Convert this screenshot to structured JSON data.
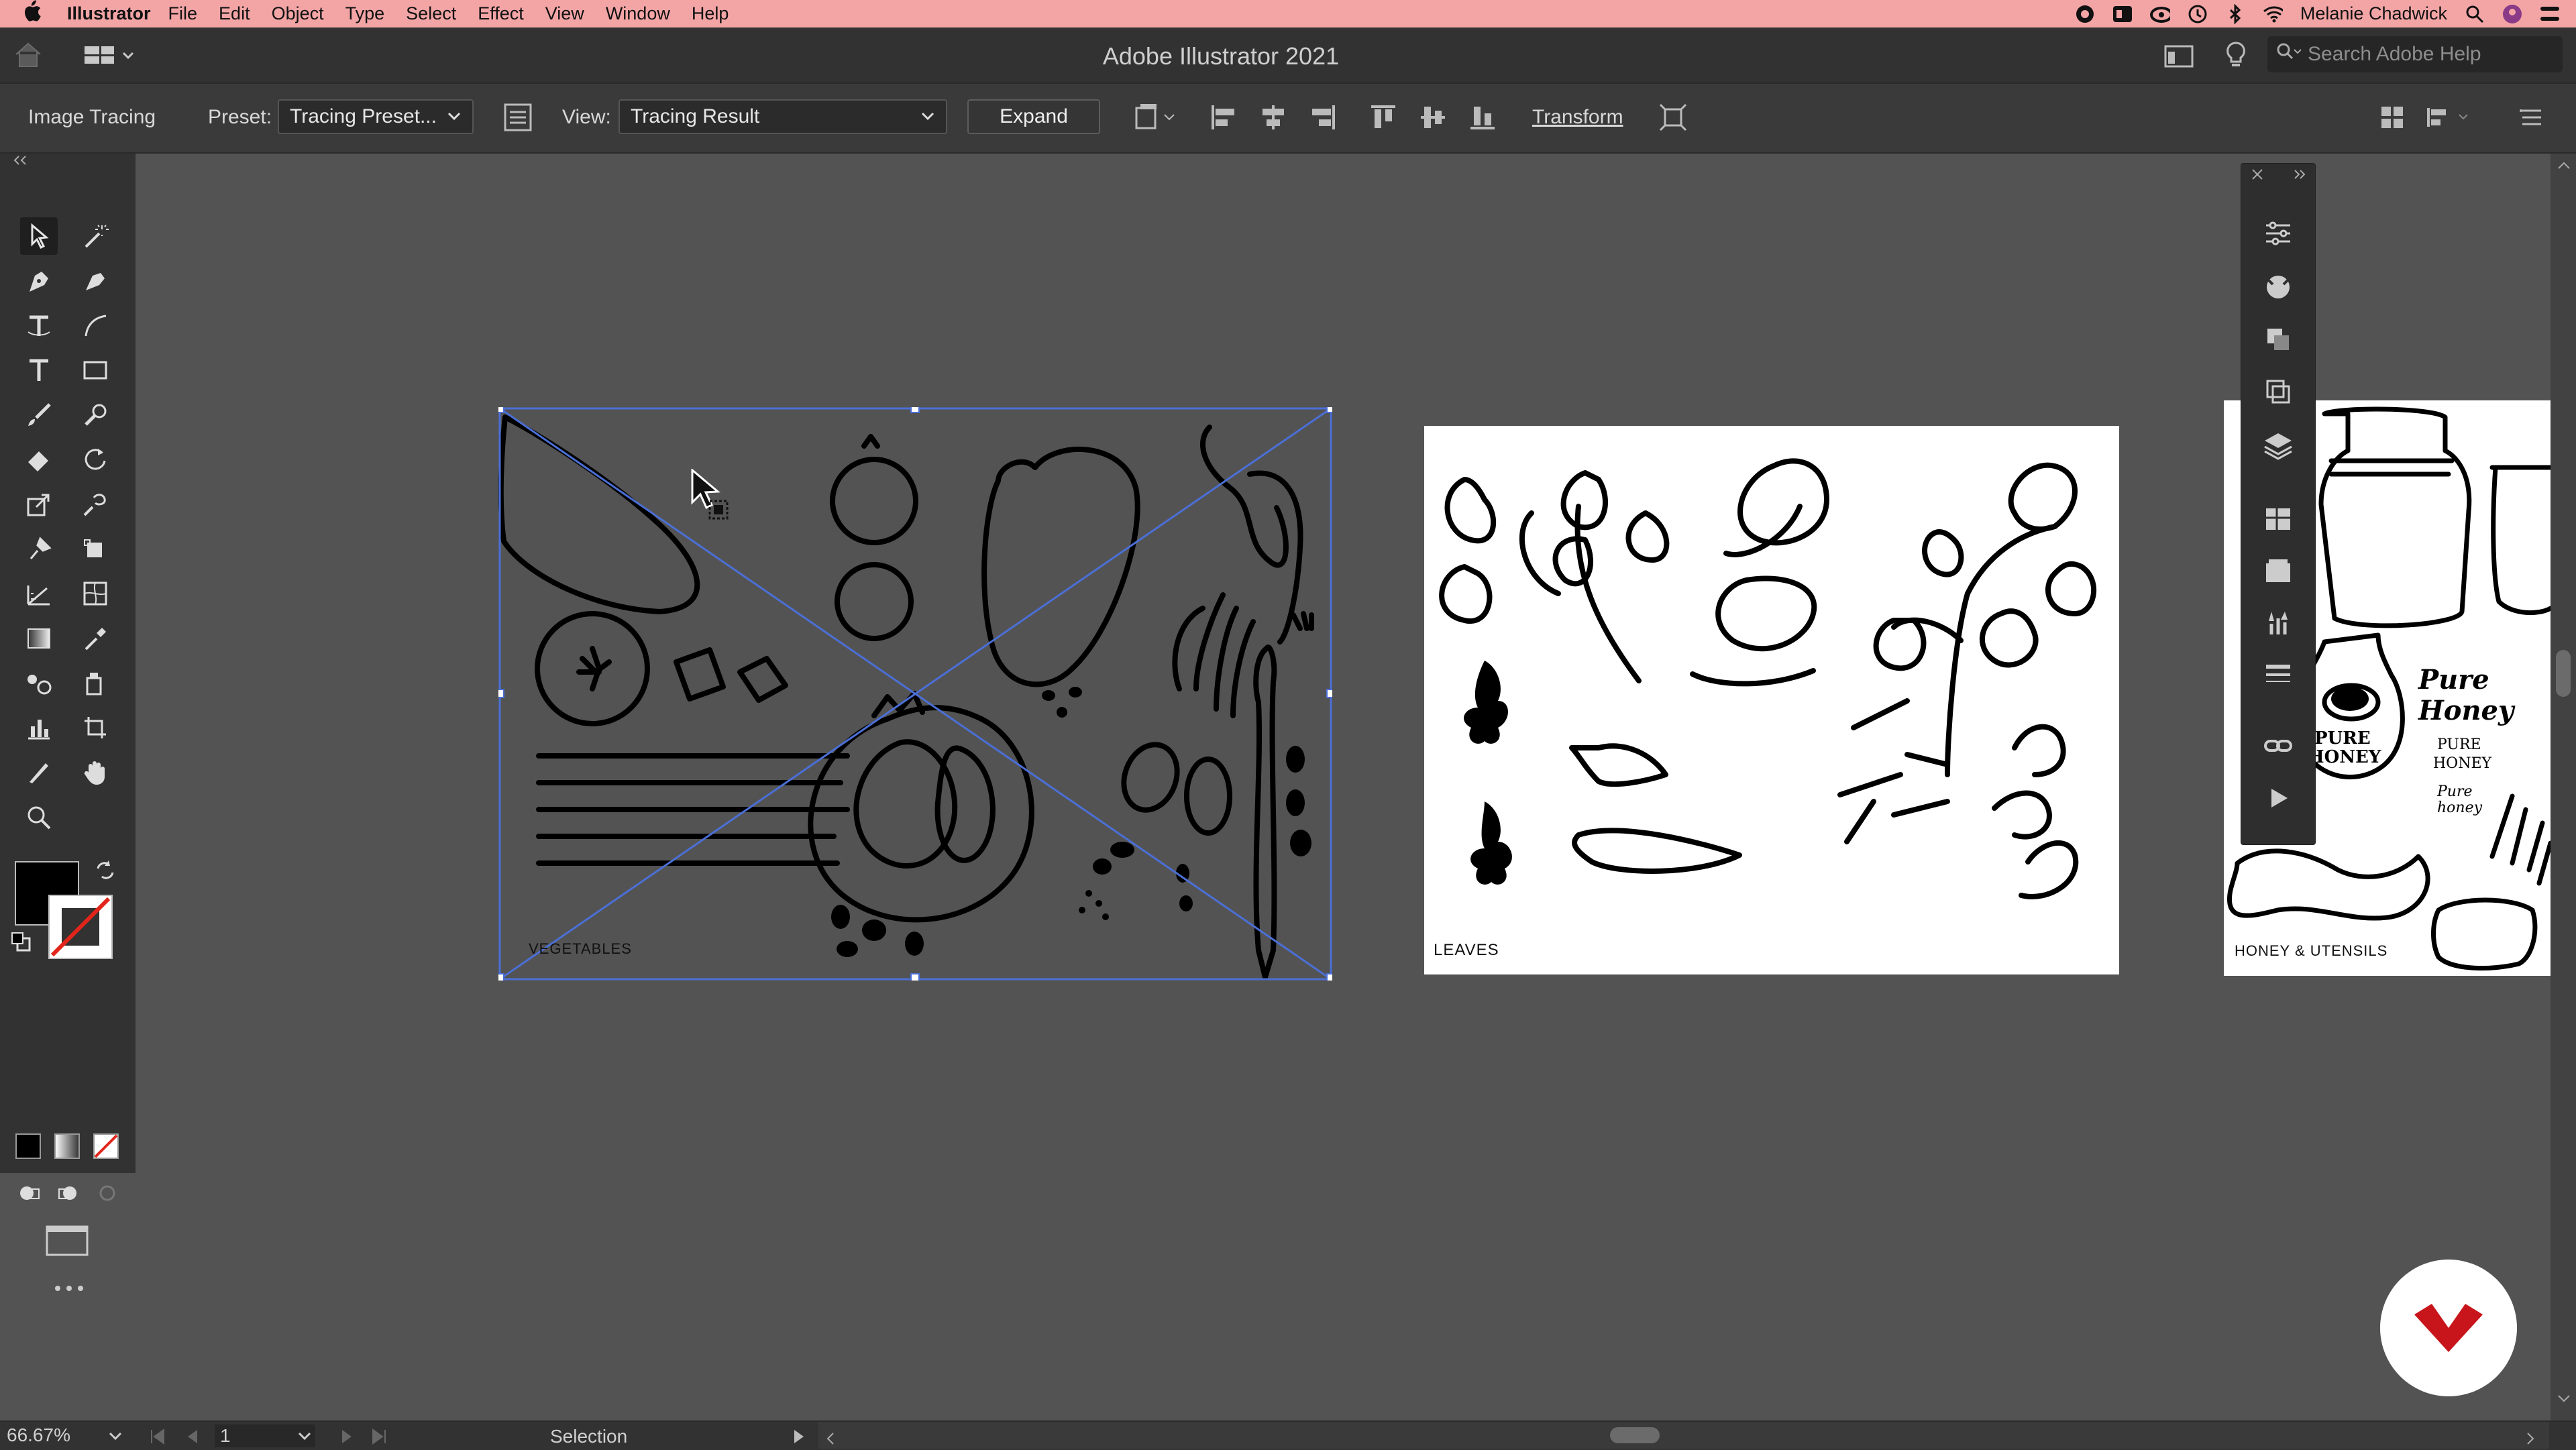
{
  "menubar": {
    "app_name": "Illustrator",
    "menus": [
      "File",
      "Edit",
      "Object",
      "Type",
      "Select",
      "Effect",
      "View",
      "Window",
      "Help"
    ],
    "user_name": "Melanie Chadwick",
    "status_icons": [
      "record-icon",
      "display-icon",
      "creative-cloud-icon",
      "time-machine-icon",
      "bluetooth-icon",
      "wifi-icon",
      "search-icon",
      "user-icon",
      "control-center-icon"
    ]
  },
  "appbar": {
    "title": "Adobe Illustrator 2021",
    "search_placeholder": "Search Adobe Help"
  },
  "controlbar": {
    "panel_name": "Image Tracing",
    "preset_label": "Preset:",
    "preset_value": "Tracing Preset...",
    "view_label": "View:",
    "view_value": "Tracing Result",
    "expand_label": "Expand",
    "transform_label": "Transform"
  },
  "artboards": [
    {
      "name": "VEGETABLES"
    },
    {
      "name": "LEAVES"
    },
    {
      "name": "HONEY & UTENSILS",
      "text": [
        "Pure",
        "Honey",
        "PURE",
        "HONEY",
        "PURE",
        "HONEY",
        "Pure",
        "honey"
      ]
    }
  ],
  "statusbar": {
    "zoom": "66.67%",
    "artboard_number": "1",
    "tool_name": "Selection"
  },
  "colors": {
    "menubar_bg": "#f3a5a6",
    "ui_dark": "#323232",
    "canvas": "#535353",
    "selection_blue": "#4b6fd6",
    "brand_red": "#c8151b"
  }
}
